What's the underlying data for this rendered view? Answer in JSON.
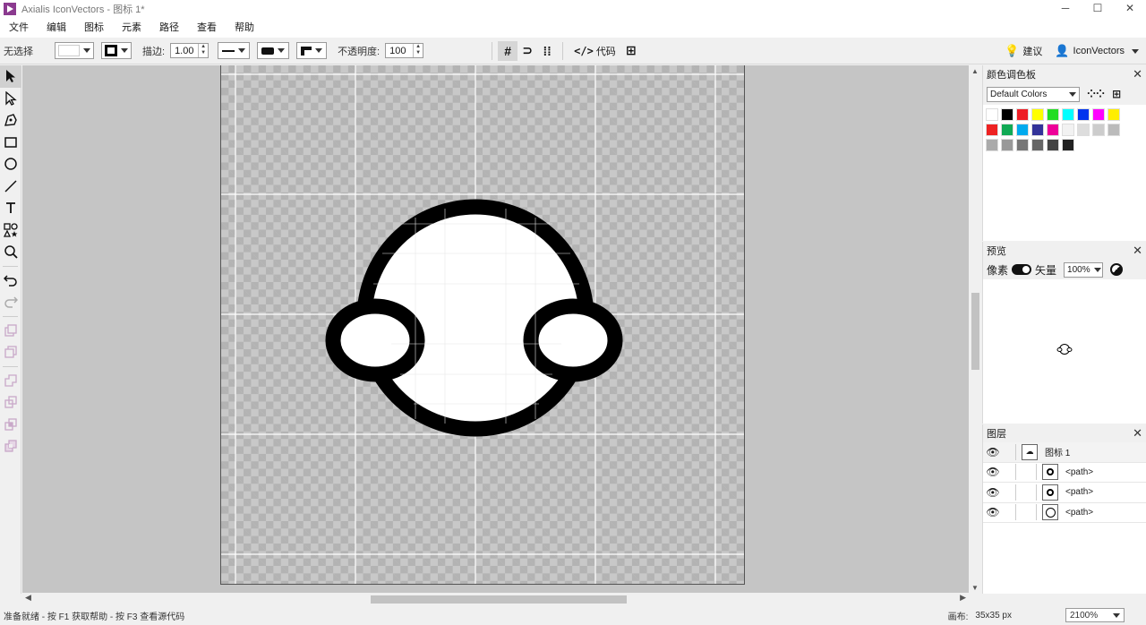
{
  "window": {
    "title": "Axialis IconVectors - 图标 1*",
    "minimize": "─",
    "maximize": "☐",
    "close": "✕"
  },
  "menu": [
    "文件",
    "编辑",
    "图标",
    "元素",
    "路径",
    "查看",
    "帮助"
  ],
  "toolbar": {
    "selection_label": "无选择",
    "stroke_label": "描边:",
    "stroke_value": "1.00",
    "opacity_label": "不透明度:",
    "opacity_value": "100",
    "code_label": "代码",
    "suggest_label": "建议",
    "account_label": "IconVectors"
  },
  "colors_panel": {
    "title": "颜色调色板",
    "palette": "Default Colors",
    "swatches": [
      "#ffffff",
      "#000000",
      "#ee1c24",
      "#ffff00",
      "#22dd22",
      "#00ffff",
      "#0033ee",
      "#ff00ff",
      "#ffee00",
      "#ee2222",
      "#11aa55",
      "#00aaee",
      "#333399",
      "#ee0099",
      "#f2f2f2",
      "#dddddd",
      "#cccccc",
      "#bbbbbb",
      "#aaaaaa",
      "#999999",
      "#777777",
      "#666666",
      "#444444",
      "#222222"
    ]
  },
  "preview_panel": {
    "title": "预览",
    "pixel_label": "像素",
    "vector_label": "矢量",
    "zoom": "100%"
  },
  "layers_panel": {
    "title": "图层",
    "rows": [
      {
        "label": "图标 1"
      },
      {
        "label": "<path>"
      },
      {
        "label": "<path>"
      },
      {
        "label": "<path>"
      }
    ]
  },
  "status": {
    "message": "准备就绪 - 按 F1 获取帮助 - 按 F3 查看源代码",
    "canvas_label": "画布:",
    "canvas_size": "35x35 px",
    "zoom": "2100%"
  },
  "icons": {
    "select_tool": "arrow-icon",
    "direct_select": "direct-select-icon",
    "pen": "pen-icon",
    "rect": "rectangle-icon",
    "ellipse": "ellipse-icon",
    "line": "line-icon",
    "text": "text-icon",
    "shapes": "shapes-icon",
    "zoom": "zoom-icon",
    "undo": "undo-icon",
    "redo": "redo-icon"
  }
}
